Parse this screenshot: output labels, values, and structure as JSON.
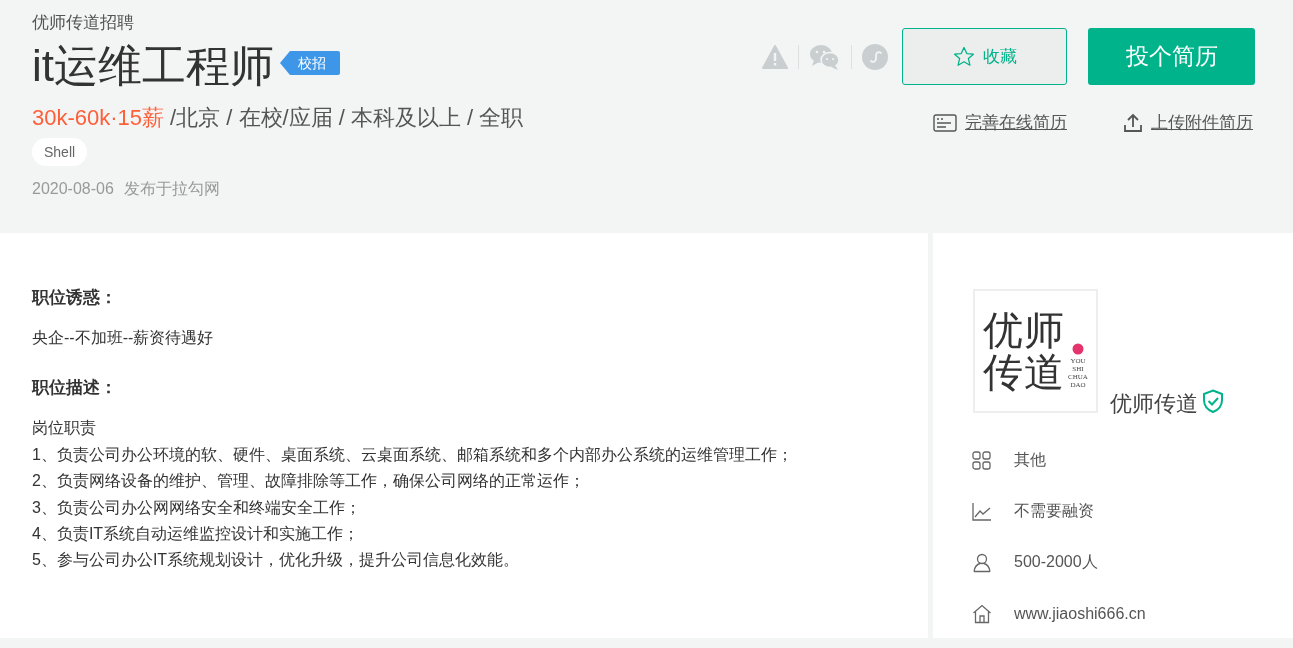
{
  "header": {
    "company_label": "优师传道招聘",
    "title": "it运维工程师",
    "badge": "校招",
    "salary": "30k-60k·15薪",
    "requirements": "/北京 / 在校/应届 / 本科及以上 / 全职",
    "tags": [
      "Shell"
    ],
    "date": "2020-08-06",
    "source": "发布于拉勾网"
  },
  "actions": {
    "favorite": {
      "label": "收藏",
      "selected": false
    },
    "apply": "投个简历",
    "links": [
      {
        "kind": "resume",
        "label": "完善在线简历"
      },
      {
        "kind": "upload",
        "label": "上传附件简历"
      }
    ]
  },
  "sections": [
    {
      "heading": "职位诱惑：",
      "lines": [
        "央企--不加班--薪资待遇好"
      ]
    },
    {
      "heading": "职位描述：",
      "lines": [
        "岗位职责",
        "1、负责公司办公环境的软、硬件、桌面系统、云桌面系统、邮箱系统和多个内部办公系统的运维管理工作；",
        "2、负责网络设备的维护、管理、故障排除等工作，确保公司网络的正常运作；",
        "3、负责公司办公网网络安全和终端安全工作；",
        "4、负责IT系统自动运维监控设计和实施工作；",
        "5、参与公司办公IT系统规划设计，优化升级，提升公司信息化效能。"
      ]
    }
  ],
  "company": {
    "logo_text": [
      "优师",
      "传道"
    ],
    "logo_latin": [
      "YOU",
      "SHI",
      "CHUA",
      "DAO"
    ],
    "name": "优师传道",
    "verified": true,
    "info": [
      {
        "kind": "industry",
        "text": "其他"
      },
      {
        "kind": "finance",
        "text": "不需要融资"
      },
      {
        "kind": "size",
        "text": "500-2000人"
      },
      {
        "kind": "website",
        "text": "www.jiaoshi666.cn"
      }
    ]
  }
}
